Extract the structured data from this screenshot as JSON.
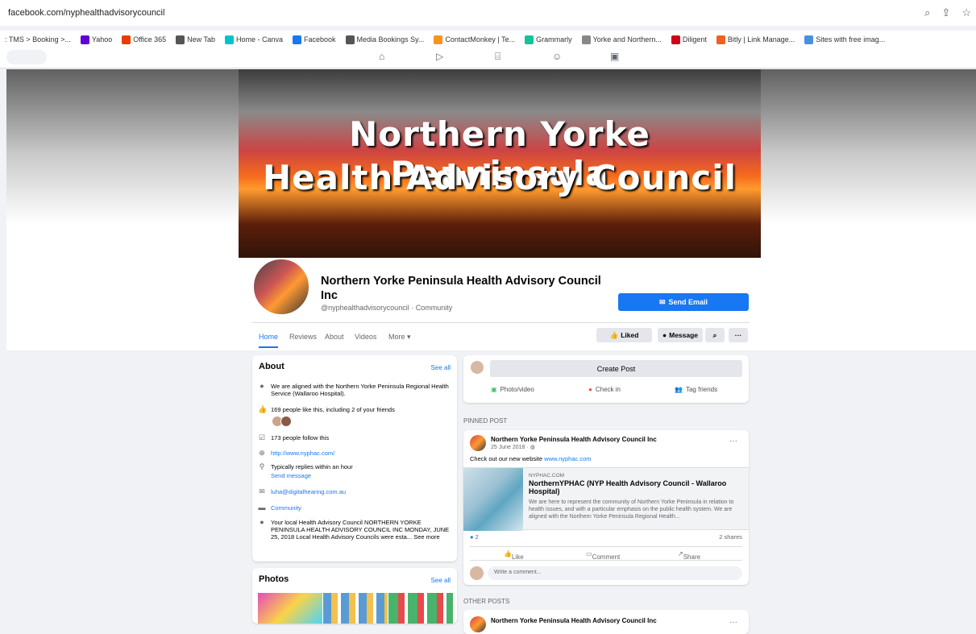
{
  "browser": {
    "url": "facebook.com/nyphealthadvisorycouncil",
    "bookmarks": [
      {
        "label": ": TMS > Booking >...",
        "color": ""
      },
      {
        "label": "Yahoo",
        "color": "#6001d2"
      },
      {
        "label": "Office 365",
        "color": "#eb3c00"
      },
      {
        "label": "New Tab",
        "color": "#555555"
      },
      {
        "label": "Home - Canva",
        "color": "#00c4cc"
      },
      {
        "label": "Facebook",
        "color": "#1877f2"
      },
      {
        "label": "Media Bookings Sy...",
        "color": "#555555"
      },
      {
        "label": "ContactMonkey | Te...",
        "color": "#f7931e"
      },
      {
        "label": "Grammarly",
        "color": "#15c39a"
      },
      {
        "label": "Yorke and Northern...",
        "color": "#888888"
      },
      {
        "label": "Diligent",
        "color": "#d0021b"
      },
      {
        "label": "Bitly | Link Manage...",
        "color": "#ee6123"
      },
      {
        "label": "Sites with free imag...",
        "color": "#4a90e2"
      }
    ]
  },
  "cover": {
    "line1": "Northern Yorke Penninsula",
    "line2": "Health Advisory Council"
  },
  "page": {
    "name": "Northern Yorke Peninsula Health Advisory Council Inc",
    "handle": "@nyphealthadvisorycouncil · Community",
    "send_email": "Send Email"
  },
  "tabs": [
    "Home",
    "Reviews",
    "About",
    "Videos",
    "More ▾"
  ],
  "actions": {
    "liked": "Liked",
    "message": "Message"
  },
  "about": {
    "title": "About",
    "see_all": "See all",
    "desc": "We are aligned with the Northern Yorke Peninsula Regional Health Service (Wallaroo Hospital).",
    "likes": "169 people like this, including 2 of your friends",
    "follows": "173 people follow this",
    "website": "http://www.nyphac.com/",
    "replies": "Typically replies within an hour",
    "send_message": "Send message",
    "email": "luha@digitalhearing.com.au",
    "category": "Community",
    "story": "Your local Health Advisory Council NORTHERN YORKE PENINSULA HEALTH ADVISORY COUNCIL INC MONDAY, JUNE 25, 2018 Local Health Advisory Councils were esta...",
    "see_more": "See more"
  },
  "photos": {
    "title": "Photos",
    "see_all": "See all"
  },
  "create_post": {
    "label": "Create Post",
    "photo": "Photo/video",
    "checkin": "Check in",
    "tag": "Tag friends"
  },
  "pinned_label": "PINNED POST",
  "other_label": "OTHER POSTS",
  "pinned": {
    "author": "Northern Yorke Peninsula Health Advisory Council Inc",
    "date": "25 June 2018 · ◍",
    "text_prefix": "Check out our new website",
    "text_link": "www.nyphac.com",
    "link_domain": "NYPHAC.COM",
    "link_title": "NorthernYPHAC (NYP Health Advisory Council - Wallaroo Hospital)",
    "link_desc": "We are here to represent the community of Northern Yorke Peninsula in relation to health issues, and with a particular emphasis on the public health system. We are aligned with the Northern Yorke Peninsula Regional Health...",
    "reactions": "2",
    "shares": "2 shares",
    "like": "Like",
    "comment": "Comment",
    "share": "Share",
    "write_comment": "Write a comment..."
  },
  "other": {
    "author": "Northern Yorke Peninsula Health Advisory Council Inc"
  }
}
